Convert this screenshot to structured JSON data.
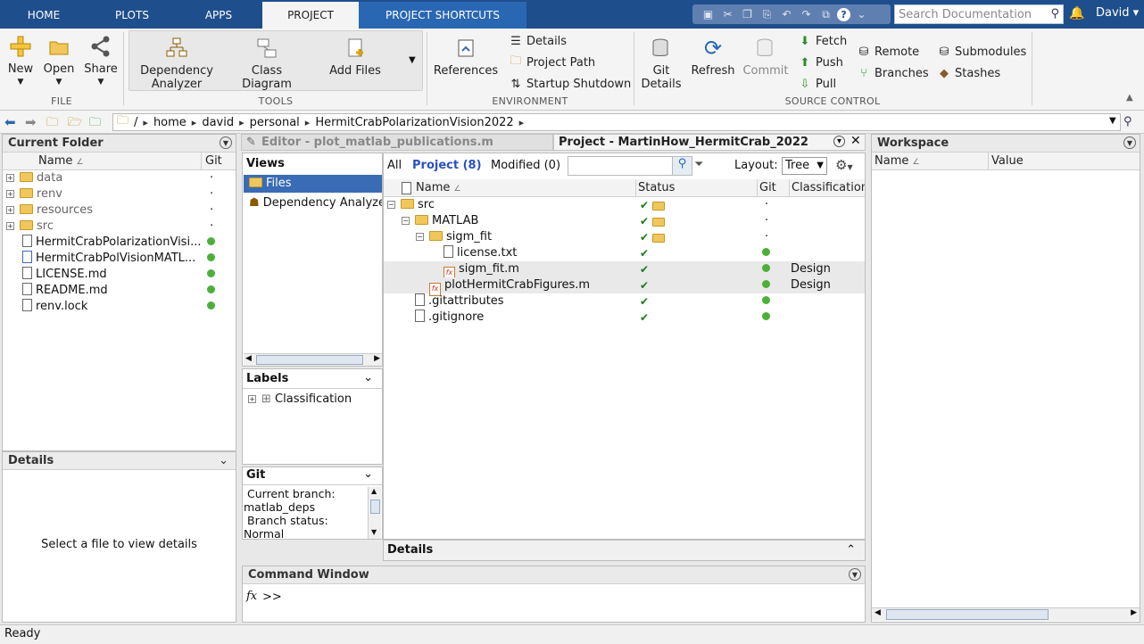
{
  "tabs": {
    "home": "HOME",
    "plots": "PLOTS",
    "apps": "APPS",
    "project": "PROJECT",
    "shortcuts": "PROJECT SHORTCUTS"
  },
  "search": {
    "placeholder": "Search Documentation"
  },
  "user": {
    "name": "David"
  },
  "toolstrip": {
    "file": {
      "new": "New",
      "open": "Open",
      "share": "Share",
      "group": "FILE"
    },
    "tools": {
      "dependency": "Dependency Analyzer",
      "class_diagram": "Class Diagram",
      "add_files": "Add Files",
      "group": "TOOLS"
    },
    "environment": {
      "references": "References",
      "details": "Details",
      "project_path": "Project Path",
      "startup_shutdown": "Startup Shutdown",
      "group": "ENVIRONMENT"
    },
    "source_control": {
      "git_details": "Git Details",
      "refresh": "Refresh",
      "commit": "Commit",
      "fetch": "Fetch",
      "push": "Push",
      "pull": "Pull",
      "remote": "Remote",
      "branches": "Branches",
      "submodules": "Submodules",
      "stashes": "Stashes",
      "group": "SOURCE CONTROL"
    }
  },
  "address": {
    "root": "/",
    "crumbs": [
      "home",
      "david",
      "personal",
      "HermitCrabPolarizationVision2022"
    ]
  },
  "current_folder": {
    "title": "Current Folder",
    "col_name": "Name",
    "col_git": "Git",
    "items": [
      {
        "name": "data",
        "type": "folder",
        "git": "·"
      },
      {
        "name": "renv",
        "type": "folder",
        "git": "·"
      },
      {
        "name": "resources",
        "type": "folder",
        "git": "·"
      },
      {
        "name": "src",
        "type": "folder",
        "git": "·"
      },
      {
        "name": "HermitCrabPolarizationVisi...",
        "type": "file",
        "git": "dot"
      },
      {
        "name": "HermitCrabPolVisionMATL...",
        "type": "project",
        "git": "dot"
      },
      {
        "name": "LICENSE.md",
        "type": "file",
        "git": "dot"
      },
      {
        "name": "README.md",
        "type": "file",
        "git": "dot"
      },
      {
        "name": "renv.lock",
        "type": "file",
        "git": "dot"
      }
    ],
    "details_title": "Details",
    "details_msg": "Select a file to view details"
  },
  "editor_tab": "Editor - plot_matlab_publications.m",
  "project_tab": "Project - MartinHow_HermitCrab_2022",
  "views": {
    "title": "Views",
    "items": [
      "Files",
      "Dependency Analyzer"
    ]
  },
  "labels": {
    "title": "Labels",
    "item": "Classification"
  },
  "git_panel": {
    "title": "Git",
    "lines": [
      "Current branch:",
      "matlab_deps",
      "Branch status:",
      "Normal"
    ]
  },
  "project_files": {
    "filter_all": "All",
    "filter_project": "Project (8)",
    "filter_modified": "Modified (0)",
    "layout_label": "Layout:",
    "layout_value": "Tree",
    "cols": {
      "name": "Name",
      "status": "Status",
      "git": "Git",
      "classification": "Classification"
    },
    "rows": [
      {
        "name": "src",
        "level": 0,
        "type": "folder",
        "exp": "⊟",
        "status": "✔",
        "git": "·",
        "cls": ""
      },
      {
        "name": "MATLAB",
        "level": 1,
        "type": "folder",
        "exp": "⊟",
        "status": "✔",
        "git": "·",
        "cls": ""
      },
      {
        "name": "sigm_fit",
        "level": 2,
        "type": "folder",
        "exp": "⊟",
        "status": "✔",
        "git": "·",
        "cls": ""
      },
      {
        "name": "license.txt",
        "level": 3,
        "type": "file",
        "exp": "",
        "status": "✔",
        "git": "dot",
        "cls": ""
      },
      {
        "name": "sigm_fit.m",
        "level": 3,
        "type": "mfile",
        "exp": "",
        "status": "✔",
        "git": "dot",
        "cls": "Design"
      },
      {
        "name": "plotHermitCrabFigures.m",
        "level": 2,
        "type": "mfile",
        "exp": "",
        "status": "✔",
        "git": "dot",
        "cls": "Design"
      },
      {
        "name": ".gitattributes",
        "level": 1,
        "type": "file",
        "exp": "",
        "status": "✔",
        "git": "dot",
        "cls": ""
      },
      {
        "name": ".gitignore",
        "level": 1,
        "type": "file",
        "exp": "",
        "status": "✔",
        "git": "dot",
        "cls": ""
      }
    ],
    "details": "Details"
  },
  "command_window": {
    "title": "Command Window",
    "prompt": ">>",
    "fx": "fx"
  },
  "workspace": {
    "title": "Workspace",
    "col_name": "Name",
    "col_value": "Value"
  },
  "status_bar": "Ready",
  "colors": {
    "tabbar": "#1f4e8c",
    "git_green": "#4caf3a",
    "selection": "#3a6bb5"
  }
}
